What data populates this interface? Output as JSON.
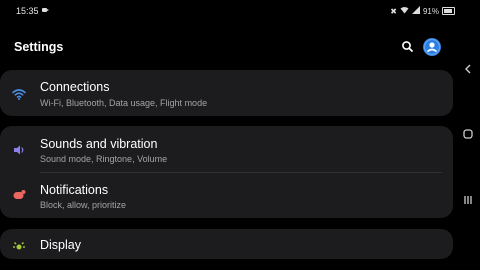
{
  "status_bar": {
    "time": "15:35",
    "battery": "91%"
  },
  "header": {
    "title": "Settings"
  },
  "groups": [
    {
      "items": [
        {
          "title": "Connections",
          "subtitle": "Wi-Fi, Bluetooth, Data usage, Flight mode",
          "icon": "wifi-icon",
          "color": "#4b8fe5"
        }
      ]
    },
    {
      "items": [
        {
          "title": "Sounds and vibration",
          "subtitle": "Sound mode, Ringtone, Volume",
          "icon": "speaker-icon",
          "color": "#8b7fe8"
        },
        {
          "title": "Notifications",
          "subtitle": "Block, allow, prioritize",
          "icon": "notification-icon",
          "color": "#e8675f"
        }
      ]
    },
    {
      "items": [
        {
          "title": "Display",
          "icon": "display-brightness-icon",
          "color": "#a7c938"
        }
      ]
    }
  ],
  "colors": {
    "background": "#000000",
    "card": "#1c1c1e",
    "subtitle": "#a4a4a4",
    "accent": "#2b7fe3"
  },
  "nav_bar": {
    "icons": [
      "back-chevron-icon",
      "home-icon",
      "recents-icon"
    ]
  }
}
